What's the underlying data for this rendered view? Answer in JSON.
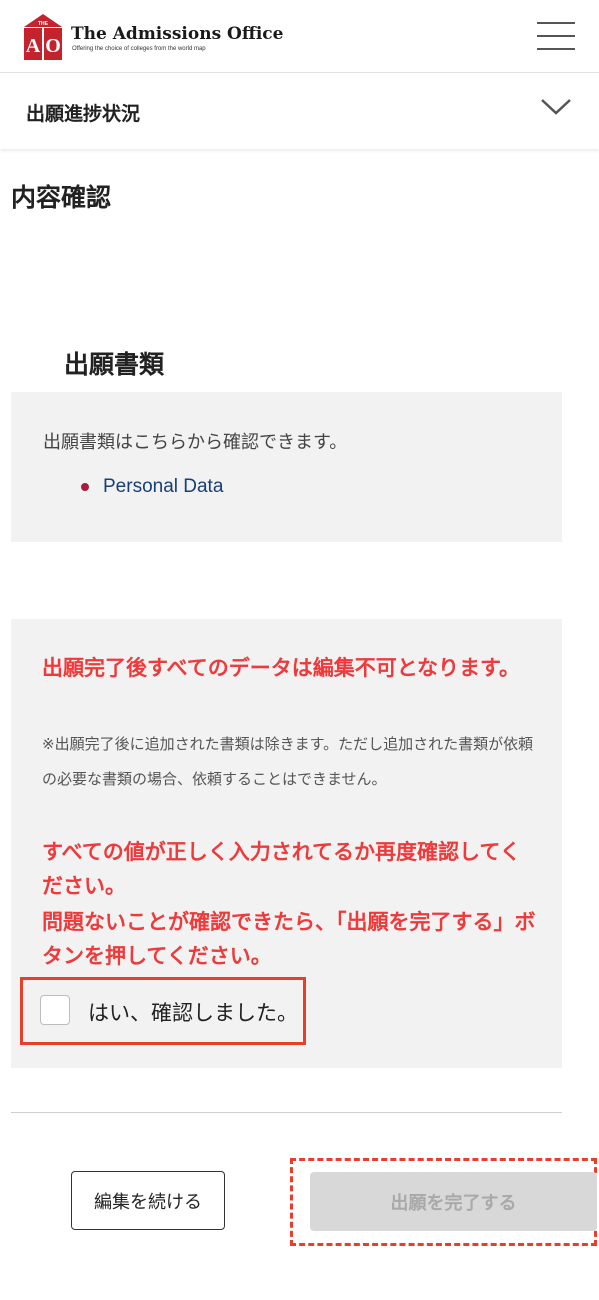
{
  "header": {
    "logo_small_text": "THE",
    "logo_letters": "AO",
    "title": "The Admissions Office",
    "tagline": "Offering the choice of colleges from the world map",
    "brand_color": "#c4232e"
  },
  "progress": {
    "label": "出願進捗状況"
  },
  "page": {
    "title": "内容確認"
  },
  "documents": {
    "section_title": "出願書類",
    "note": "出願書類はこちらから確認できます。",
    "links": [
      {
        "label": "Personal Data"
      }
    ]
  },
  "warning": {
    "main": "出願完了後すべてのデータは編集不可となります。",
    "small": "※出願完了後に追加された書類は除きます。ただし追加された書類が依頼の必要な書類の場合、依頼することはできません。",
    "recheck": "すべての値が正しく入力されてるか再度確認してください。",
    "instruction": "問題ないことが確認できたら、「出願を完了する」ボタンを押してください。",
    "color": "#ee3a3a"
  },
  "confirm": {
    "label": "はい、確認しました。",
    "checked": false
  },
  "buttons": {
    "continue_label": "編集を続ける",
    "complete_label": "出願を完了する",
    "complete_enabled": false
  },
  "highlight_color": "#e83e2c"
}
